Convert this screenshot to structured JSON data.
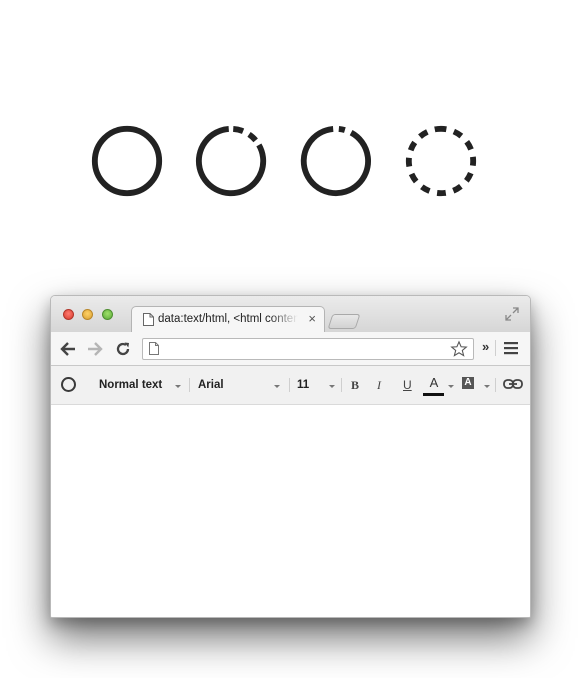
{
  "loader_icons": [
    {
      "name": "spinner-solid"
    },
    {
      "name": "spinner-gapped"
    },
    {
      "name": "spinner-gapped-small"
    },
    {
      "name": "spinner-dashed"
    }
  ],
  "browser": {
    "tab": {
      "title": "data:text/html, <html contenteditable>",
      "close_label": "×"
    },
    "omnibox": {
      "value": "",
      "placeholder": ""
    },
    "toolbar": {
      "overflow_label": "»"
    }
  },
  "editor_toolbar": {
    "style_dropdown": "Normal text",
    "font_dropdown": "Arial",
    "size_dropdown": "11",
    "bold_label": "B",
    "italic_label": "I",
    "underline_label": "U",
    "text_color_label": "A",
    "highlight_label": "A",
    "text_color": "#111111"
  },
  "colors": {
    "icon_dark": "#222222"
  }
}
